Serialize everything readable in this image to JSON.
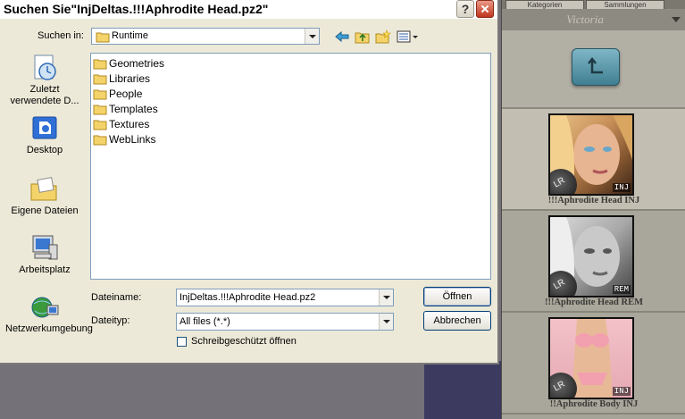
{
  "dialog": {
    "title": "Suchen Sie\"InjDeltas.!!!Aphrodite Head.pz2\"",
    "help_label": "?",
    "look_in_label": "Suchen in:",
    "look_in_value": "Runtime",
    "places": [
      {
        "label": "Zuletzt verwendete D...",
        "icon": "recent-documents-icon"
      },
      {
        "label": "Desktop",
        "icon": "desktop-icon"
      },
      {
        "label": "Eigene Dateien",
        "icon": "my-documents-icon"
      },
      {
        "label": "Arbeitsplatz",
        "icon": "my-computer-icon"
      },
      {
        "label": "Netzwerkumgebung",
        "icon": "network-icon"
      }
    ],
    "files": [
      "Geometries",
      "Libraries",
      "People",
      "Templates",
      "Textures",
      "WebLinks"
    ],
    "filename_label": "Dateiname:",
    "filename_value": "InjDeltas.!!!Aphrodite Head.pz2",
    "filetype_label": "Dateityp:",
    "filetype_value": "All files (*.*)",
    "open_button": "Öffnen",
    "cancel_button": "Abbrechen",
    "readonly_label": "Schreibgeschützt öffnen",
    "readonly_checked": false
  },
  "library": {
    "header": "Victoria",
    "tabs": [
      "Kategorien",
      "Sammlungen"
    ],
    "items": [
      {
        "label": "!!!Aphrodite Head INJ",
        "badge": "INJ",
        "logo": "LR",
        "selected": true
      },
      {
        "label": "!!!Aphrodite Head REM",
        "badge": "REM",
        "logo": "LR",
        "selected": false
      },
      {
        "label": "!!Aphrodite Body INJ",
        "badge": "INJ",
        "logo": "LR",
        "selected": false
      }
    ]
  }
}
